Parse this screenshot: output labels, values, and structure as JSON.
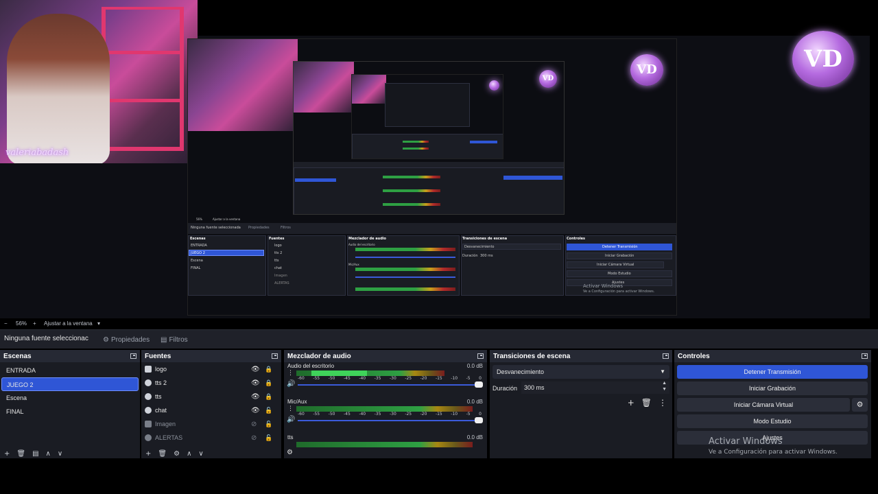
{
  "preview": {
    "webcam_signature": "valeriabadash",
    "nested": {
      "no_source": "Ninguna fuente seleccionada",
      "properties": "Propiedades",
      "filters": "Filtros",
      "zoom": "56%",
      "fit": "Ajustar a la ventana",
      "scenes_title": "Escenas",
      "sources_title": "Fuentes",
      "mixer_title": "Mezclador de audio",
      "transitions_title": "Transiciones de escena",
      "controls_title": "Controles",
      "scenes": [
        "ENTRADA",
        "JUEGO 2",
        "Escena",
        "FINAL"
      ],
      "sources": [
        "logo",
        "tts 2",
        "tts",
        "chat",
        "Imagen",
        "ALERTAS"
      ],
      "desktop_audio": "Audio del escritorio",
      "mic": "Mic/Aux",
      "transition": "Desvanecimiento",
      "duration_label": "Duración",
      "duration": "300 ms",
      "buttons": [
        "Detener Transmisión",
        "Iniciar Grabación",
        "Iniciar Cámara Virtual",
        "Modo Estudio",
        "Ajustes"
      ],
      "watermark_title": "Activar Windows",
      "watermark_sub": "Ve a Configuración para activar Windows."
    }
  },
  "zoombar": {
    "minus": "−",
    "zoom": "56%",
    "plus": "+",
    "fit": "Ajustar a la ventana",
    "caret": "▾"
  },
  "source_toolbar": {
    "no_source": "Ninguna fuente seleccionac",
    "properties": "Propiedades",
    "filters": "Filtros"
  },
  "scenes_dock": {
    "title": "Escenas",
    "items": [
      {
        "label": "ENTRADA",
        "selected": false
      },
      {
        "label": "JUEGO 2",
        "selected": true
      },
      {
        "label": "Escena",
        "selected": false
      },
      {
        "label": "FINAL",
        "selected": false
      }
    ]
  },
  "sources_dock": {
    "title": "Fuentes",
    "items": [
      {
        "label": "logo",
        "icon": "image-icon",
        "visible": true,
        "locked": true
      },
      {
        "label": "tts 2",
        "icon": "browser-icon",
        "visible": true,
        "locked": true
      },
      {
        "label": "tts",
        "icon": "browser-icon",
        "visible": true,
        "locked": true
      },
      {
        "label": "chat",
        "icon": "browser-icon",
        "visible": true,
        "locked": false
      },
      {
        "label": "Imagen",
        "icon": "image-icon",
        "visible": false,
        "locked": false
      },
      {
        "label": "ALERTAS",
        "icon": "browser-icon",
        "visible": false,
        "locked": false
      }
    ]
  },
  "mixer_dock": {
    "title": "Mezclador de audio",
    "channels": [
      {
        "name": "Audio del escritorio",
        "db": "0.0 dB",
        "level": 0.8,
        "peak": 0.3
      },
      {
        "name": "Mic/Aux",
        "db": "0.0 dB",
        "level": 0.95,
        "peak": 0.0
      },
      {
        "name": "tts",
        "db": "0.0 dB",
        "level": 0.95,
        "peak": 0.0
      }
    ],
    "ticks": [
      "-60",
      "-55",
      "-50",
      "-45",
      "-40",
      "-35",
      "-30",
      "-25",
      "-20",
      "-15",
      "-10",
      "-5",
      "0"
    ]
  },
  "transitions_dock": {
    "title": "Transiciones de escena",
    "transition": "Desvanecimiento",
    "duration_label": "Duración",
    "duration": "300 ms"
  },
  "controls_dock": {
    "title": "Controles",
    "stop_stream": "Detener Transmisión",
    "start_recording": "Iniciar Grabación",
    "start_virtual_cam": "Iniciar Cámara Virtual",
    "studio_mode": "Modo Estudio",
    "settings": "Ajustes"
  },
  "windows_watermark": {
    "title": "Activar Windows",
    "subtitle": "Ve a Configuración para activar Windows."
  },
  "colors": {
    "accent": "#2f56d6",
    "panel": "#1a1c23",
    "header": "#262934"
  }
}
